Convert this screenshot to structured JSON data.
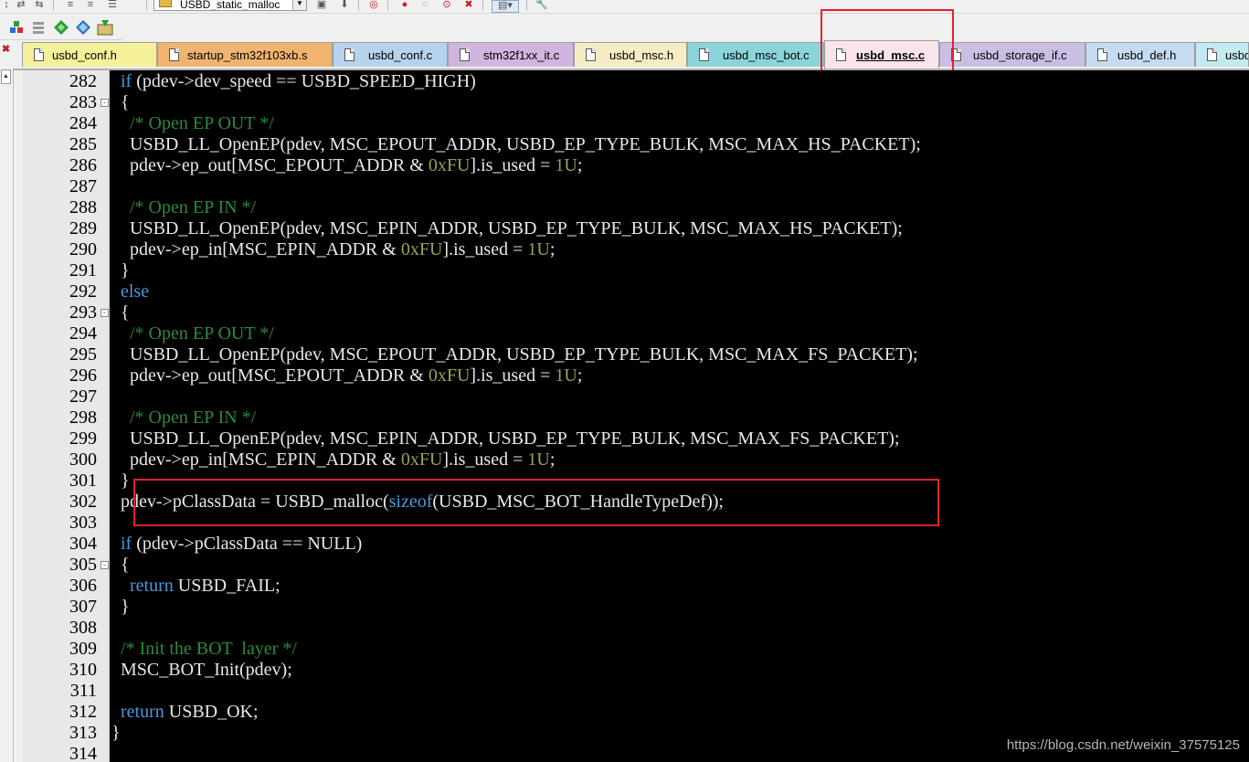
{
  "toolbar": {
    "target_name": "USBD_static_malloc"
  },
  "tabs": [
    {
      "label": "usbd_conf.h",
      "color": "#f5f09a",
      "active": false
    },
    {
      "label": "startup_stm32f103xb.s",
      "color": "#f0b470",
      "active": false
    },
    {
      "label": "usbd_conf.c",
      "color": "#b6d2ec",
      "active": false
    },
    {
      "label": "stm32f1xx_it.c",
      "color": "#cfb5df",
      "active": false
    },
    {
      "label": "usbd_msc.h",
      "color": "#f6ecc4",
      "active": false
    },
    {
      "label": "usbd_msc_bot.c",
      "color": "#8bd4da",
      "active": false
    },
    {
      "label": "usbd_msc.c",
      "color": "#fbe3eb",
      "active": true
    },
    {
      "label": "usbd_storage_if.c",
      "color": "#cbbee4",
      "active": false
    },
    {
      "label": "usbd_def.h",
      "color": "#c6daf2",
      "active": false
    },
    {
      "label": "usbd_",
      "color": "#c2eaf0",
      "active": false
    }
  ],
  "editor": {
    "lines": [
      {
        "n": "282",
        "fold": "",
        "code": [
          [
            "  "
          ],
          [
            "if",
            "kw"
          ],
          [
            " (pdev->dev_speed == USBD_SPEED_HIGH)"
          ]
        ]
      },
      {
        "n": "283",
        "fold": "-",
        "code": [
          [
            "  {"
          ]
        ]
      },
      {
        "n": "284",
        "fold": "",
        "code": [
          [
            "    "
          ],
          [
            "/* Open EP OUT */",
            "cm"
          ]
        ]
      },
      {
        "n": "285",
        "fold": "",
        "code": [
          [
            "    USBD_LL_OpenEP(pdev, MSC_EPOUT_ADDR, USBD_EP_TYPE_BULK, MSC_MAX_HS_PACKET);"
          ]
        ]
      },
      {
        "n": "286",
        "fold": "",
        "code": [
          [
            "    pdev->ep_out[MSC_EPOUT_ADDR & "
          ],
          [
            "0xFU",
            "nm"
          ],
          [
            "].is_used = "
          ],
          [
            "1U",
            "nm"
          ],
          [
            ";"
          ]
        ]
      },
      {
        "n": "287",
        "fold": "",
        "code": [
          [
            ""
          ]
        ]
      },
      {
        "n": "288",
        "fold": "",
        "code": [
          [
            "    "
          ],
          [
            "/* Open EP IN */",
            "cm"
          ]
        ]
      },
      {
        "n": "289",
        "fold": "",
        "code": [
          [
            "    USBD_LL_OpenEP(pdev, MSC_EPIN_ADDR, USBD_EP_TYPE_BULK, MSC_MAX_HS_PACKET);"
          ]
        ]
      },
      {
        "n": "290",
        "fold": "",
        "code": [
          [
            "    pdev->ep_in[MSC_EPIN_ADDR & "
          ],
          [
            "0xFU",
            "nm"
          ],
          [
            "].is_used = "
          ],
          [
            "1U",
            "nm"
          ],
          [
            ";"
          ]
        ]
      },
      {
        "n": "291",
        "fold": "",
        "code": [
          [
            "  }"
          ]
        ]
      },
      {
        "n": "292",
        "fold": "",
        "code": [
          [
            "  "
          ],
          [
            "else",
            "kw"
          ]
        ]
      },
      {
        "n": "293",
        "fold": "-",
        "code": [
          [
            "  {"
          ]
        ]
      },
      {
        "n": "294",
        "fold": "",
        "code": [
          [
            "    "
          ],
          [
            "/* Open EP OUT */",
            "cm"
          ]
        ]
      },
      {
        "n": "295",
        "fold": "",
        "code": [
          [
            "    USBD_LL_OpenEP(pdev, MSC_EPOUT_ADDR, USBD_EP_TYPE_BULK, MSC_MAX_FS_PACKET);"
          ]
        ]
      },
      {
        "n": "296",
        "fold": "",
        "code": [
          [
            "    pdev->ep_out[MSC_EPOUT_ADDR & "
          ],
          [
            "0xFU",
            "nm"
          ],
          [
            "].is_used = "
          ],
          [
            "1U",
            "nm"
          ],
          [
            ";"
          ]
        ]
      },
      {
        "n": "297",
        "fold": "",
        "code": [
          [
            ""
          ]
        ]
      },
      {
        "n": "298",
        "fold": "",
        "code": [
          [
            "    "
          ],
          [
            "/* Open EP IN */",
            "cm"
          ]
        ]
      },
      {
        "n": "299",
        "fold": "",
        "code": [
          [
            "    USBD_LL_OpenEP(pdev, MSC_EPIN_ADDR, USBD_EP_TYPE_BULK, MSC_MAX_FS_PACKET);"
          ]
        ]
      },
      {
        "n": "300",
        "fold": "",
        "code": [
          [
            "    pdev->ep_in[MSC_EPIN_ADDR & "
          ],
          [
            "0xFU",
            "nm"
          ],
          [
            "].is_used = "
          ],
          [
            "1U",
            "nm"
          ],
          [
            ";"
          ]
        ]
      },
      {
        "n": "301",
        "fold": "",
        "code": [
          [
            "  }"
          ]
        ]
      },
      {
        "n": "302",
        "fold": "",
        "code": [
          [
            "  pdev->pClassData = USBD_malloc("
          ],
          [
            "sizeof",
            "kw"
          ],
          [
            "(USBD_MSC_BOT_HandleTypeDef));"
          ]
        ]
      },
      {
        "n": "303",
        "fold": "",
        "code": [
          [
            ""
          ]
        ]
      },
      {
        "n": "304",
        "fold": "",
        "code": [
          [
            "  "
          ],
          [
            "if",
            "kw"
          ],
          [
            " (pdev->pClassData == NULL)"
          ]
        ]
      },
      {
        "n": "305",
        "fold": "-",
        "code": [
          [
            "  {"
          ]
        ]
      },
      {
        "n": "306",
        "fold": "",
        "code": [
          [
            "    "
          ],
          [
            "return",
            "kw"
          ],
          [
            " USBD_FAIL;"
          ]
        ]
      },
      {
        "n": "307",
        "fold": "",
        "code": [
          [
            "  }"
          ]
        ]
      },
      {
        "n": "308",
        "fold": "",
        "code": [
          [
            ""
          ]
        ]
      },
      {
        "n": "309",
        "fold": "",
        "code": [
          [
            "  "
          ],
          [
            "/* Init the BOT  layer */",
            "cm"
          ]
        ]
      },
      {
        "n": "310",
        "fold": "",
        "code": [
          [
            "  MSC_BOT_Init(pdev);"
          ]
        ]
      },
      {
        "n": "311",
        "fold": "",
        "code": [
          [
            ""
          ]
        ]
      },
      {
        "n": "312",
        "fold": "",
        "code": [
          [
            "  "
          ],
          [
            "return",
            "kw"
          ],
          [
            " USBD_OK;"
          ]
        ]
      },
      {
        "n": "313",
        "fold": "",
        "code": [
          [
            "}"
          ]
        ]
      },
      {
        "n": "314",
        "fold": "",
        "code": [
          [
            ""
          ]
        ]
      }
    ]
  },
  "watermark": "https://blog.csdn.net/weixin_37575125",
  "colors": {
    "editor_bg": "#000000",
    "keyword": "#4b98d8",
    "comment": "#2a8a3e",
    "number": "#9f9f52",
    "highlight_box": "#e8202a"
  }
}
